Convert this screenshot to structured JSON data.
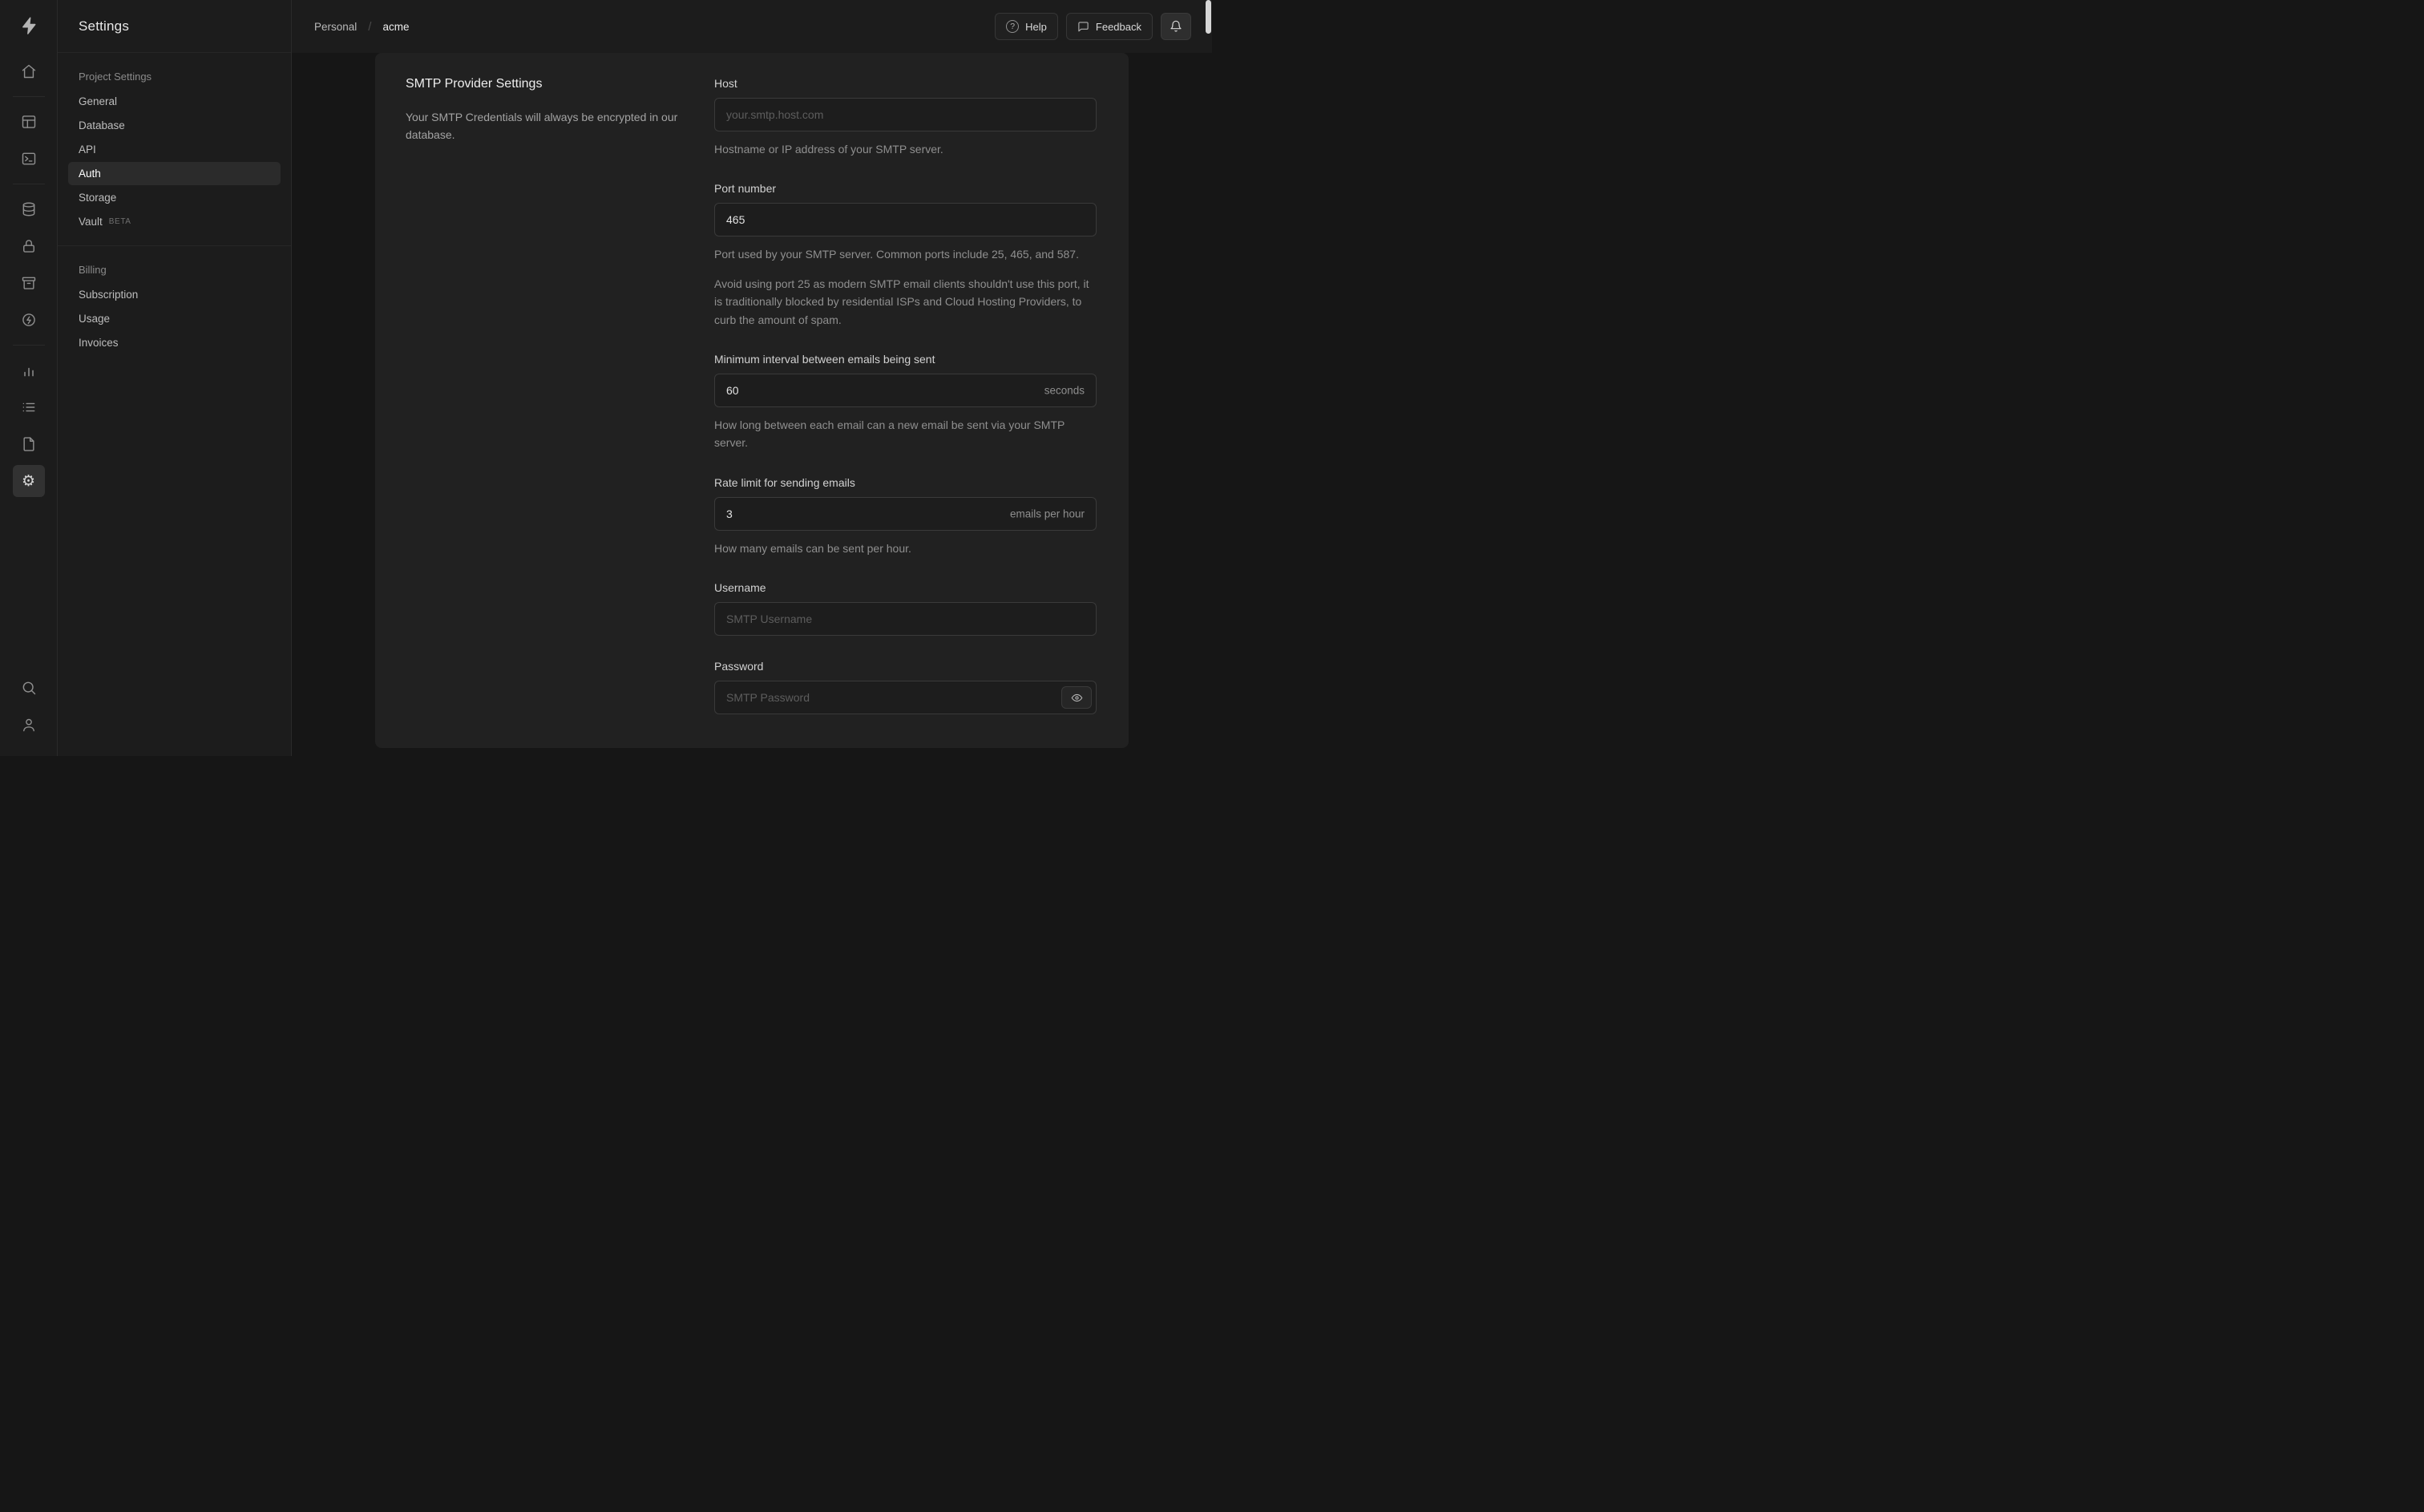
{
  "colors": {
    "background": "#161616",
    "surface": "#1c1c1c",
    "panel": "#212121",
    "border": "#2e2e2e"
  },
  "icon_rail": {
    "items": [
      "supabase-logo",
      "home",
      "table-editor",
      "sql-editor",
      "database",
      "auth",
      "storage",
      "edge-functions",
      "reports",
      "logs",
      "docs",
      "settings"
    ],
    "footer_items": [
      "search",
      "user"
    ]
  },
  "sidebar": {
    "title": "Settings",
    "sections": [
      {
        "heading": "Project Settings",
        "items": [
          {
            "label": "General"
          },
          {
            "label": "Database"
          },
          {
            "label": "API"
          },
          {
            "label": "Auth",
            "active": true
          },
          {
            "label": "Storage"
          },
          {
            "label": "Vault",
            "badge": "BETA"
          }
        ]
      },
      {
        "heading": "Billing",
        "items": [
          {
            "label": "Subscription"
          },
          {
            "label": "Usage"
          },
          {
            "label": "Invoices"
          }
        ]
      }
    ]
  },
  "header": {
    "breadcrumb": {
      "org": "Personal",
      "separator": "/",
      "project": "acme"
    },
    "help_label": "Help",
    "help_icon_glyph": "?",
    "feedback_label": "Feedback"
  },
  "main": {
    "section": {
      "title": "SMTP Provider Settings",
      "description": "Your SMTP Credentials will always be encrypted in our database.",
      "fields": {
        "host": {
          "label": "Host",
          "placeholder": "your.smtp.host.com",
          "help": "Hostname or IP address of your SMTP server."
        },
        "port": {
          "label": "Port number",
          "value": "465",
          "help": "Port used by your SMTP server. Common ports include 25, 465, and 587.",
          "note": "Avoid using port 25 as modern SMTP email clients shouldn't use this port, it is traditionally blocked by residential ISPs and Cloud Hosting Providers, to curb the amount of spam."
        },
        "interval": {
          "label": "Minimum interval between emails being sent",
          "value": "60",
          "suffix": "seconds",
          "help": "How long between each email can a new email be sent via your SMTP server."
        },
        "rate_limit": {
          "label": "Rate limit for sending emails",
          "value": "3",
          "suffix": "emails per hour",
          "help": "How many emails can be sent per hour."
        },
        "username": {
          "label": "Username",
          "placeholder": "SMTP Username"
        },
        "password": {
          "label": "Password",
          "placeholder": "SMTP Password"
        }
      }
    }
  }
}
